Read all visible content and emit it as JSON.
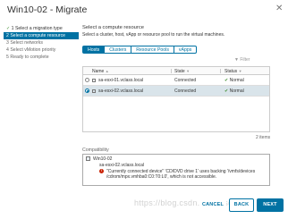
{
  "window": {
    "title": "Win10-02 - Migrate",
    "close_icon": "close-icon"
  },
  "steps": [
    {
      "number": "1",
      "label": "Select a migration type",
      "state": "done",
      "check": "✓"
    },
    {
      "number": "2",
      "label": "Select a compute resource",
      "state": "active"
    },
    {
      "number": "3",
      "label": "Select networks",
      "state": "pending"
    },
    {
      "number": "4",
      "label": "Select vMotion priority",
      "state": "pending"
    },
    {
      "number": "5",
      "label": "Ready to complete",
      "state": "pending"
    }
  ],
  "main": {
    "heading": "Select a compute resource",
    "subtitle": "Select a cluster, host, vApp or resource pool to run the virtual machines."
  },
  "tabs": [
    "Hosts",
    "Clusters",
    "Resource Pools",
    "vApps"
  ],
  "filter": {
    "icon": "filter-icon",
    "label": "Filter"
  },
  "grid": {
    "columns": [
      "Name",
      "State",
      "Status"
    ],
    "rows": [
      {
        "name": "sa-esxi-01.vclass.local",
        "state": "Connected",
        "status": "Normal",
        "selected": false
      },
      {
        "name": "sa-esxi-02.vclass.local",
        "state": "Connected",
        "status": "Normal",
        "selected": true
      }
    ],
    "count": "2 items"
  },
  "compatibility": {
    "label": "Compatibility",
    "vm_name": "Win10-02",
    "host": "sa-esxi-02.vclass.local",
    "error_line1": "\"Currently connected device\" 'CD/DVD drive 1' uses backing '/vmfs/devices",
    "error_line2": "/cdrom/mpx.vmhba0:C0:T0:L0', which is not accessible."
  },
  "buttons": {
    "cancel": "CANCEL",
    "back": "BACK",
    "next": "NEXT"
  },
  "watermark": "https://blog.csdn.net/ebsd...",
  "colors": {
    "accent": "#0072a3",
    "ok": "#3c8b2d",
    "error": "#c92100"
  }
}
